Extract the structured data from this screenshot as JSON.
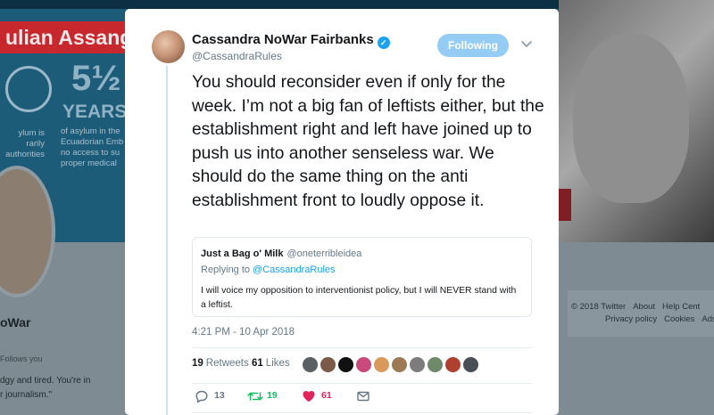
{
  "background": {
    "banner_title": "ulian Assang",
    "years_number": "5½",
    "years_label": "YEARS",
    "body_left": [
      "ylum is",
      "rarily",
      "authorities"
    ],
    "body_right": [
      "of asylum in the",
      "Ecuadorian Emb",
      "no access to su",
      "proper medical"
    ],
    "profile_name": "oWar",
    "follows_you": "Follows you",
    "bio_lines": [
      "dgy and tired. You're in",
      "r journalism.\""
    ],
    "footer_row1": [
      "© 2018 Twitter",
      "About",
      "Help Cent"
    ],
    "footer_row2": [
      "Privacy policy",
      "Cookies",
      "Ads"
    ]
  },
  "tweet": {
    "author_name": "Cassandra NoWar Fairbanks",
    "verified_glyph": "✓",
    "handle": "@CassandraRules",
    "follow_label": "Following",
    "text": "You should reconsider even if only for the week. I’m not a big fan of leftists either, but the establishment right and left have joined up to push us into another senseless war. We should do the same thing on the anti establishment front to loudly oppose it.",
    "quote": {
      "author_name": "Just a Bag o' Milk",
      "handle": "@oneterribleidea",
      "replying_label": "Replying to",
      "replying_to": "@CassandraRules",
      "text": "I will voice my opposition to interventionist policy,  but I will NEVER stand with a leftist."
    },
    "timestamp": "4:21 PM - 10 Apr 2018",
    "retweets_count": "19",
    "retweets_label": "Retweets",
    "likes_count": "61",
    "likes_label": "Likes",
    "liker_avatars": [
      {
        "name": "liker-avatar-1",
        "color": "#5a5f63"
      },
      {
        "name": "liker-avatar-2",
        "color": "#7b5a4a"
      },
      {
        "name": "liker-avatar-3",
        "color": "#111111"
      },
      {
        "name": "liker-avatar-4",
        "color": "#c94a7a"
      },
      {
        "name": "liker-avatar-5",
        "color": "#d89a5a"
      },
      {
        "name": "liker-avatar-6",
        "color": "#9c7a56"
      },
      {
        "name": "liker-avatar-7",
        "color": "#7d7d7d"
      },
      {
        "name": "liker-avatar-8",
        "color": "#6f8a6a"
      },
      {
        "name": "liker-avatar-9",
        "color": "#b04030"
      },
      {
        "name": "liker-avatar-10",
        "color": "#4a4f56"
      }
    ],
    "actions": {
      "reply_count": "13",
      "retweet_count": "19",
      "like_count": "61"
    }
  },
  "colors": {
    "brand_blue": "#1da1f2",
    "retweet_green": "#17bf63",
    "like_red": "#e0245e",
    "muted_text": "#657786"
  },
  "icons": [
    "verified-icon",
    "chevron-down-icon",
    "reply-icon",
    "retweet-icon",
    "heart-icon",
    "message-icon"
  ]
}
